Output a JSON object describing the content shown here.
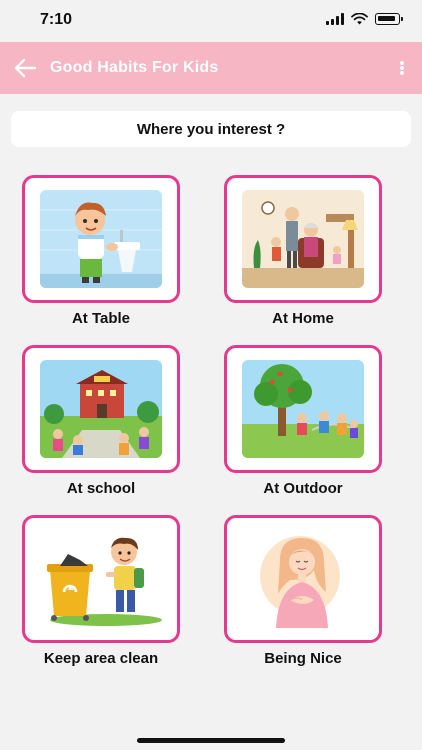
{
  "status_bar": {
    "time": "7:10",
    "icons": [
      "signal-icon",
      "wifi-icon",
      "battery-icon"
    ]
  },
  "app_bar": {
    "title": "Good Habits For Kids",
    "back_icon": "arrow-left-icon",
    "menu_icon": "more-vertical-icon",
    "background": "#f6b6c3"
  },
  "question": "Where you interest ?",
  "accent_color": "#e6398e",
  "categories": [
    {
      "label": "At Table",
      "image": "boy-washing-hands-illustration"
    },
    {
      "label": "At Home",
      "image": "family-at-home-illustration"
    },
    {
      "label": "At school",
      "image": "children-at-school-illustration"
    },
    {
      "label": "At Outdoor",
      "image": "kids-playing-outdoor-illustration"
    },
    {
      "label": "Keep area clean",
      "image": "boy-with-recycle-bin-illustration"
    },
    {
      "label": "Being Nice",
      "image": "girl-with-hands-on-heart-illustration"
    }
  ]
}
